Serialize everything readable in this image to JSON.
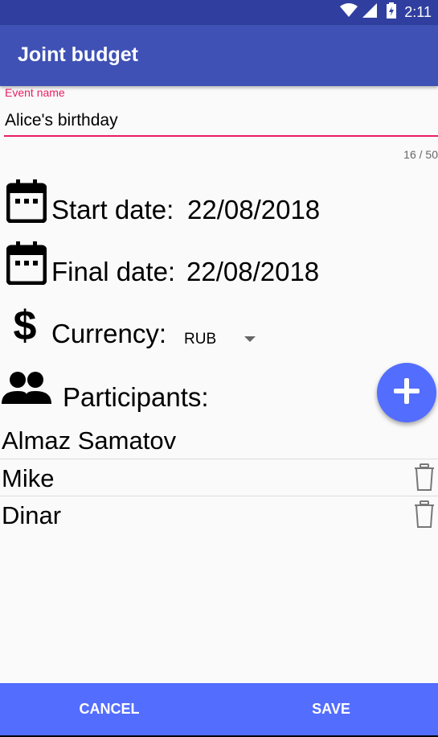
{
  "status_bar": {
    "time": "2:11"
  },
  "app_bar": {
    "title": "Joint budget"
  },
  "event_name": {
    "label": "Event name",
    "value": "Alice's birthday",
    "counter": "16 / 50"
  },
  "start_date": {
    "label": "Start date:",
    "value": "22/08/2018"
  },
  "final_date": {
    "label": "Final date:",
    "value": "22/08/2018"
  },
  "currency": {
    "label": "Currency:",
    "value": "RUB"
  },
  "participants": {
    "label": "Participants:",
    "items": [
      {
        "name": "Almaz Samatov",
        "deletable": false
      },
      {
        "name": "Mike",
        "deletable": true
      },
      {
        "name": "Dinar",
        "deletable": true
      }
    ]
  },
  "buttons": {
    "cancel": "CANCEL",
    "save": "SAVE"
  },
  "colors": {
    "status_bar": "#303f9f",
    "app_bar": "#3f51b5",
    "accent": "#e91e63",
    "fab": "#536dfe",
    "bottom_bar": "#536dfe"
  }
}
